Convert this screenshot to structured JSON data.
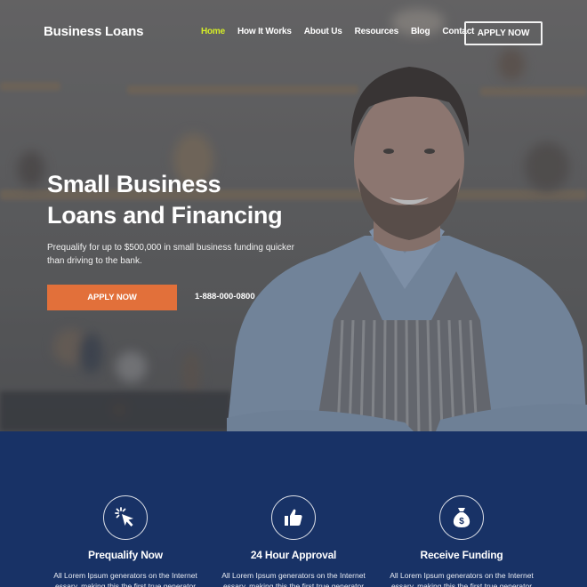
{
  "nav": {
    "brand": "Business Loans",
    "items": [
      {
        "label": "Home",
        "active": true
      },
      {
        "label": "How It Works",
        "active": false
      },
      {
        "label": "About Us",
        "active": false
      },
      {
        "label": "Resources",
        "active": false
      },
      {
        "label": "Blog",
        "active": false
      },
      {
        "label": "Contact",
        "active": false
      }
    ],
    "cta_label": "APPLY NOW"
  },
  "hero": {
    "title_line1": "Small Business",
    "title_line2": "Loans and Financing",
    "subtitle": "Prequalify for up to $500,000 in small business funding quicker than driving to the bank.",
    "cta_label": "APPLY NOW",
    "phone": "1-888-000-0800",
    "image_alt": "smiling-business-owner-in-apron"
  },
  "features": [
    {
      "icon": "cursor-click-icon",
      "title": "Prequalify Now",
      "text": "All Lorem Ipsum generators on the Internet essary, making this the first true generator"
    },
    {
      "icon": "thumbs-up-icon",
      "title": "24 Hour Approval",
      "text": "All Lorem Ipsum generators on the Internet essary, making this the first true generator"
    },
    {
      "icon": "money-bag-icon",
      "title": "Receive Funding",
      "text": "All Lorem Ipsum generators on the Internet essary, making this the first true generator"
    }
  ],
  "colors": {
    "accent_orange": "#e2703a",
    "active_nav": "#d4ec27",
    "navy": "#183266"
  }
}
